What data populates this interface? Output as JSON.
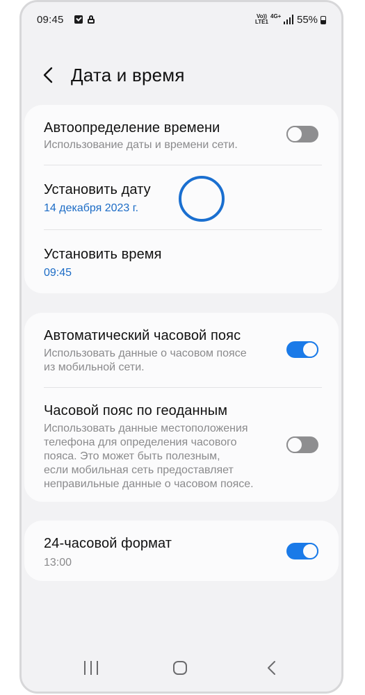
{
  "status_bar": {
    "time": "09:45",
    "volte_label": "Vo)) LTE1",
    "network_label": "4G+",
    "battery_percent": "55%",
    "battery_level": 0.55,
    "icons": [
      "message-icon",
      "lock-icon",
      "signal-icon",
      "battery-icon"
    ]
  },
  "header": {
    "title": "Дата и время",
    "back_icon": "chevron-left-icon"
  },
  "sections": [
    {
      "items": [
        {
          "title": "Автоопределение времени",
          "subtitle": "Использование даты и времени сети.",
          "toggle": false
        },
        {
          "title": "Установить дату",
          "value": "14 декабря 2023 г."
        },
        {
          "title": "Установить время",
          "value": "09:45"
        }
      ]
    },
    {
      "items": [
        {
          "title": "Автоматический часовой пояс",
          "subtitle_lines": [
            "Использовать данные о часовом поясе",
            "из мобильной сети."
          ],
          "toggle": true
        },
        {
          "title": "Часовой пояс по геоданным",
          "subtitle_lines": [
            "Использовать данные местоположения",
            "телефона для определения часового",
            "пояса. Это может быть полезным,",
            "если мобильная сеть предоставляет",
            "неправильные данные о часовом поясе."
          ],
          "toggle": false
        }
      ]
    },
    {
      "items": [
        {
          "title": "24-часовой формат",
          "subtitle": "13:00",
          "toggle": true
        }
      ]
    }
  ],
  "colors": {
    "accent": "#1a7ae8",
    "link": "#1c6cc6",
    "background": "#f2f2f4",
    "card": "#fbfbfc"
  },
  "nav_bar": {
    "icons": [
      "recent-apps-icon",
      "home-icon",
      "back-icon"
    ]
  }
}
